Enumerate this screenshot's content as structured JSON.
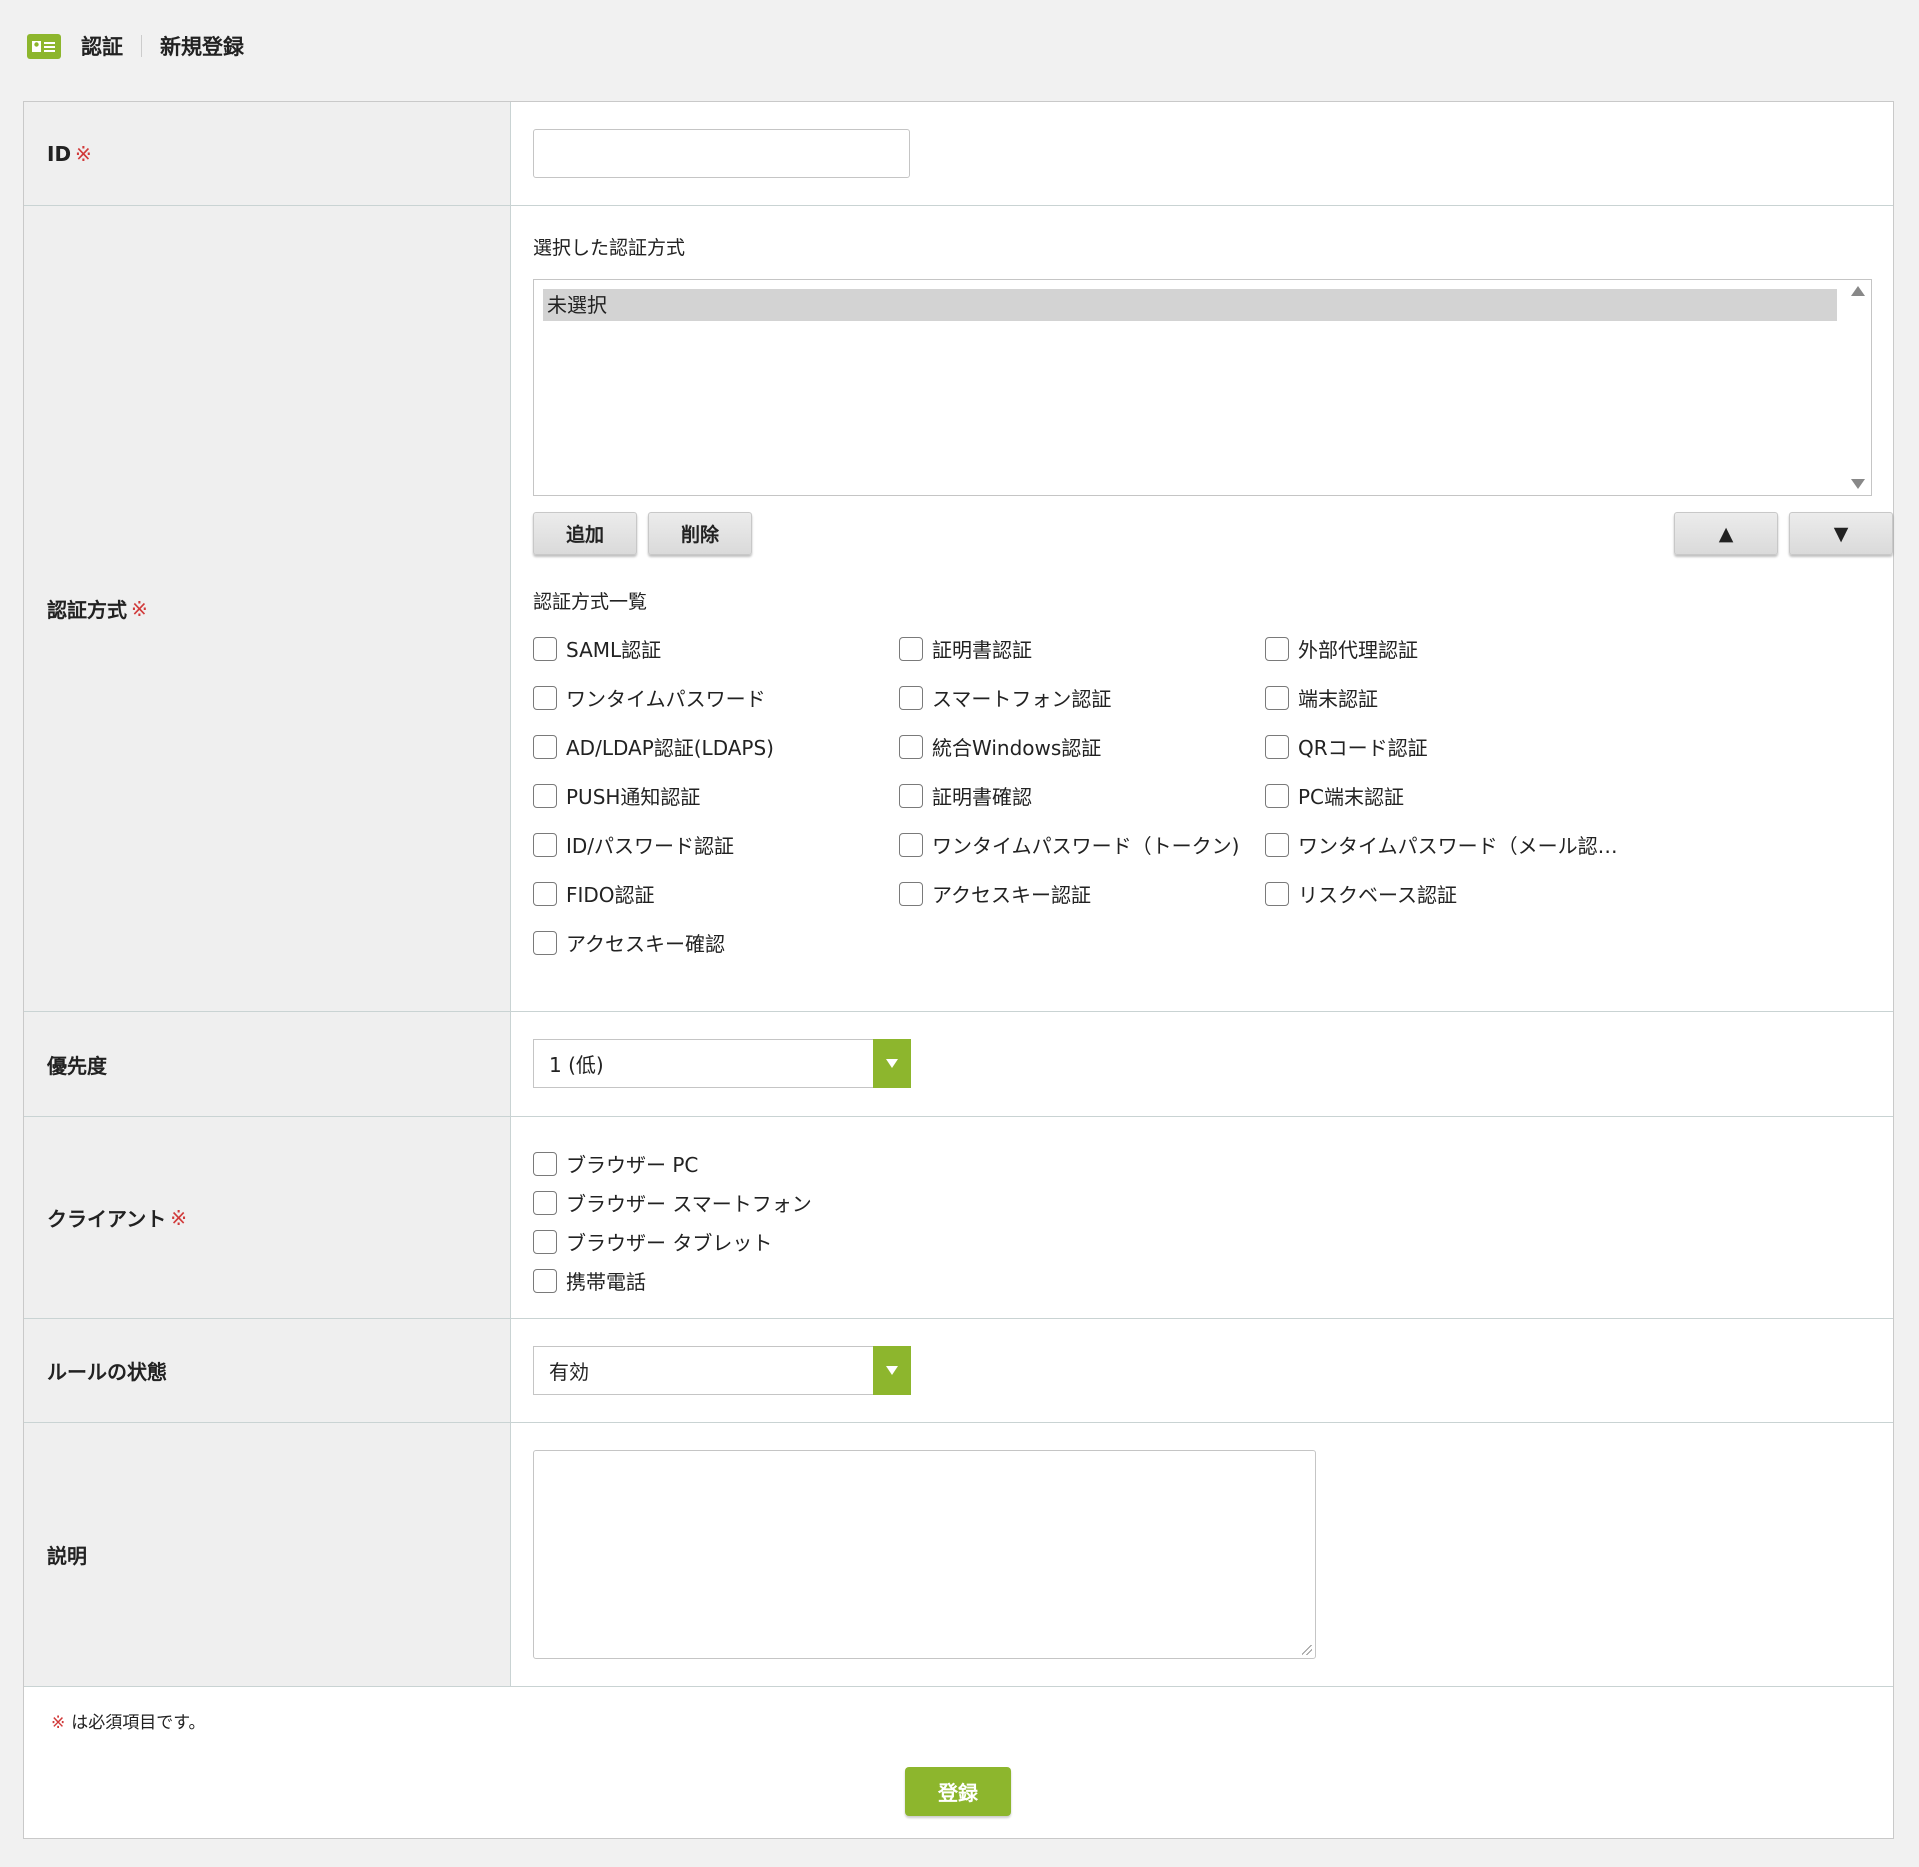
{
  "header": {
    "title": "認証",
    "subtitle": "新規登録"
  },
  "required_mark": "※",
  "fields": {
    "id": {
      "label": "ID",
      "value": ""
    },
    "auth_method": {
      "label": "認証方式",
      "selected_title": "選択した認証方式",
      "selected_items": [
        "未選択"
      ],
      "add_label": "追加",
      "delete_label": "削除",
      "up_label": "▲",
      "down_label": "▼",
      "list_title": "認証方式一覧",
      "options": [
        "SAML認証",
        "証明書認証",
        "外部代理認証",
        "ワンタイムパスワード",
        "スマートフォン認証",
        "端末認証",
        "AD/LDAP認証(LDAPS)",
        "統合Windows認証",
        "QRコード認証",
        "PUSH通知認証",
        "証明書確認",
        "PC端末認証",
        "ID/パスワード認証",
        "ワンタイムパスワード（トークン)",
        "ワンタイムパスワード（メール認…",
        "FIDO認証",
        "アクセスキー認証",
        "リスクベース認証",
        "アクセスキー確認"
      ]
    },
    "priority": {
      "label": "優先度",
      "value": "1 (低)"
    },
    "client": {
      "label": "クライアント",
      "options": [
        "ブラウザー PC",
        "ブラウザー スマートフォン",
        "ブラウザー タブレット",
        "携帯電話"
      ]
    },
    "rule_state": {
      "label": "ルールの状態",
      "value": "有効"
    },
    "description": {
      "label": "説明",
      "value": ""
    }
  },
  "footer": {
    "note": "は必須項目です。",
    "submit_label": "登録"
  },
  "colors": {
    "accent": "#8db62d",
    "required": "#d13a3a",
    "label_bg": "#efefef"
  },
  "icons": {
    "header": "id-card-icon",
    "select_arrow": "caret-down-icon"
  }
}
